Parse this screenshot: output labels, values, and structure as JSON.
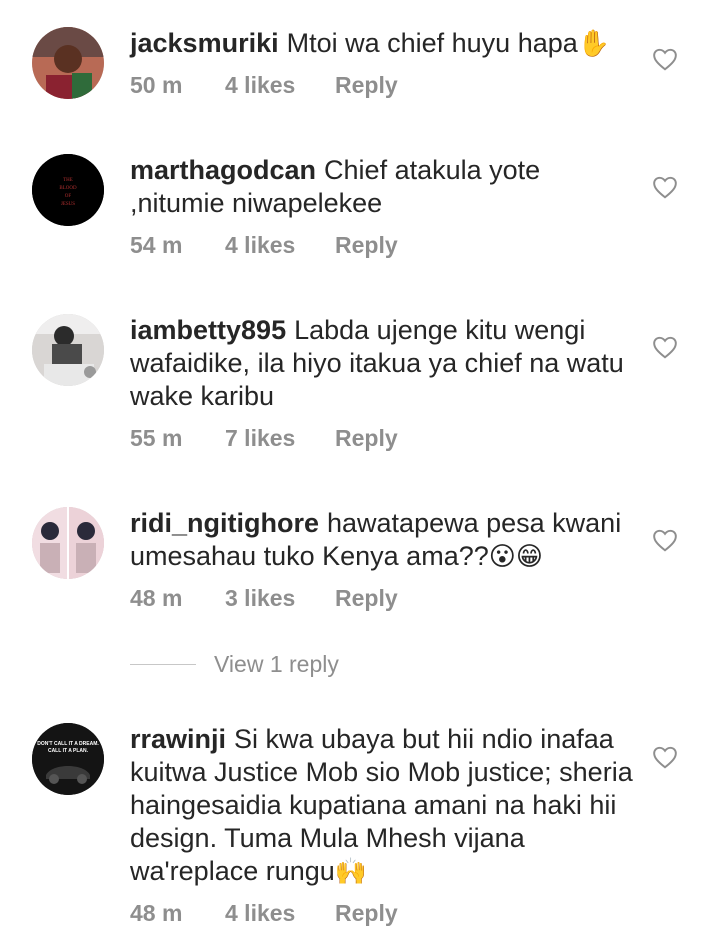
{
  "comments": [
    {
      "username": "jacksmuriki",
      "text": "Mtoi wa chief huyu hapa",
      "emoji": "✋",
      "time": "50 m",
      "likes": "4 likes",
      "reply_label": "Reply"
    },
    {
      "username": "marthagodcan",
      "text": "Chief atakula yote ,nitumie niwapelekee",
      "emoji": "",
      "time": "54 m",
      "likes": "4 likes",
      "reply_label": "Reply",
      "avatar_text": "THE BLOOD OF JESUS"
    },
    {
      "username": "iambetty895",
      "text": "Labda ujenge kitu wengi wafaidike, ila hiyo itakua ya chief na watu wake karibu",
      "emoji": "",
      "time": "55 m",
      "likes": "7 likes",
      "reply_label": "Reply"
    },
    {
      "username": "ridi_ngitighore",
      "text": "hawatapewa pesa kwani umesahau tuko Kenya ama??",
      "emoji": "😮😁",
      "time": "48 m",
      "likes": "3 likes",
      "reply_label": "Reply"
    },
    {
      "username": "rrawinji",
      "text": "Si kwa ubaya but hii ndio inafaa kuitwa Justice Mob sio Mob justice; sheria haingesaidia kupatiana amani na haki hii design. Tuma Mula Mhesh vijana wa'replace rungu",
      "emoji": "🙌",
      "time": "48 m",
      "likes": "4 likes",
      "reply_label": "Reply",
      "avatar_text": "DON'T CALL IT A DREAM. CALL IT A PLAN."
    }
  ],
  "view_replies_label": "View 1 reply",
  "colors": {
    "text": "#262626",
    "muted": "#8e8e8e",
    "heart": "#8e8e8e"
  },
  "icons": {
    "like": "heart-outline-icon"
  }
}
